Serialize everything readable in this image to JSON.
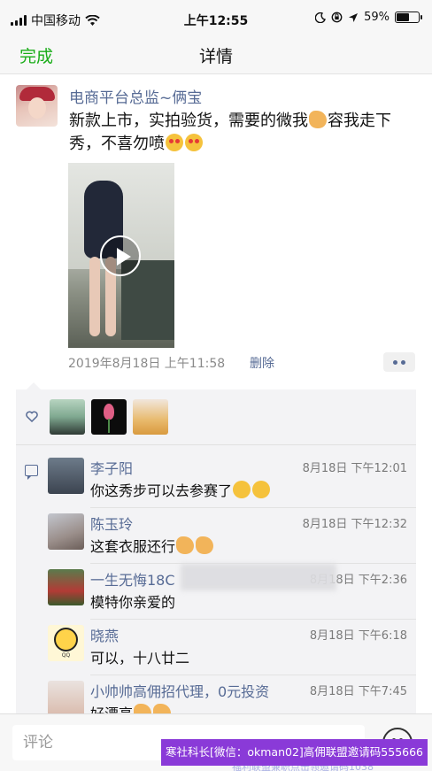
{
  "status_bar": {
    "carrier": "中国移动",
    "time": "上午12:55",
    "battery_text": "59%",
    "battery_level": 0.59,
    "icons": [
      "signal-icon",
      "wifi-icon",
      "moon-icon",
      "rotation-lock-icon",
      "location-icon",
      "battery-icon"
    ]
  },
  "nav": {
    "done_label": "完成",
    "title": "详情"
  },
  "post": {
    "author": "电商平台总监~俩宝",
    "text_part1": "新款上市，实拍验货，需要的微我",
    "text_part2": "容我走下秀，不喜勿喷",
    "time": "2019年8月18日 上午11:58",
    "delete_label": "删除"
  },
  "likes": {
    "count": 3
  },
  "comments": [
    {
      "name": "李子阳",
      "time": "8月18日 下午12:01",
      "text": "你这秀步可以去参赛了"
    },
    {
      "name": "陈玉玲",
      "time": "8月18日 下午12:32",
      "text": "这套衣服还行"
    },
    {
      "name": "一生无悔18C",
      "time": "8月18日 下午2:36",
      "text": "模特你亲爱的"
    },
    {
      "name": "晓燕",
      "time": "8月18日 下午6:18",
      "text": "可以，十八廿二"
    },
    {
      "name": "小帅帅高佣招代理，0元投资",
      "time": "8月18日 下午7:45",
      "text": "好漂亮"
    }
  ],
  "bottom": {
    "comment_placeholder": "评论"
  },
  "watermark": {
    "text": "寒社科长[微信：okman02]高佣联盟邀请码555666",
    "shadow_text": "福利联盟兼职点击领邀请码1038"
  },
  "colors": {
    "accent_green": "#1aad19",
    "link_blue": "#576b95",
    "watermark_purple": "#8a3ad8"
  }
}
